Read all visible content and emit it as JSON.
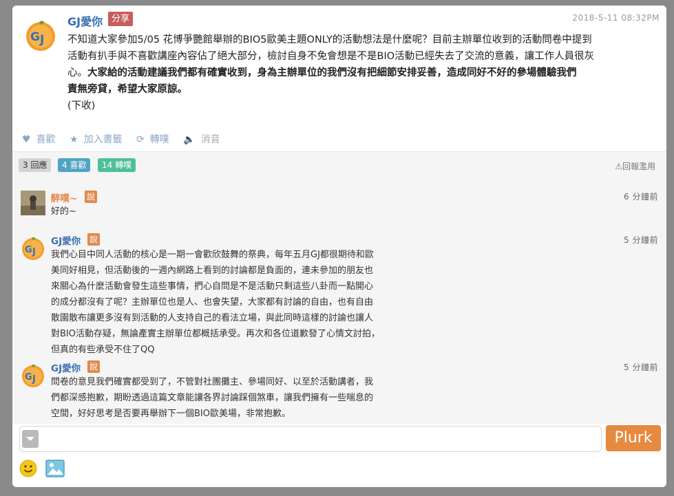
{
  "post": {
    "author": "GJ愛你",
    "qualifier": "分享",
    "timestamp": "2018-5-11 08:32PM",
    "line1": "不知道大家參加5/05 花博爭艷館舉辦的BIO5歐美主題ONLY的活動想法是什麼呢？目前主辦單位收到的活動問卷中提到",
    "line2": "活動有扒手與不喜歡講座內容佔了絕大部分，檢討自身不免會想是不是BIO活動已經失去了交流的意義，讓工作人員很灰",
    "line3a": "心。",
    "line3b": "大家給的活動建議我們都有確實收到，身為主辦單位的我們沒有把細節安排妥善，造成同好不好的參場體驗我們",
    "line4": "責無旁貸，希望大家原諒。",
    "line5": "(下收)"
  },
  "actions": {
    "like": "喜歡",
    "bookmark": "加入書籤",
    "replurk": "轉噗",
    "mute": "消音"
  },
  "stats": {
    "responses": "3 回應",
    "likes": "4 喜歡",
    "replurks": "14 轉噗",
    "report": "回報濫用"
  },
  "responses": [
    {
      "name": "醉噗~",
      "qualifier": "說",
      "time": "6 分鐘前",
      "lines": [
        "好的~"
      ],
      "name_color": "#e8834a"
    },
    {
      "name": "GJ愛你",
      "qualifier": "說",
      "time": "5 分鐘前",
      "lines": [
        "我們心目中同人活動的核心是一期一會歡欣鼓舞的祭典，每年五月GJ都很期待和歐",
        "美同好相見，但活動後的一週內網路上看到的討論都是負面的，連未參加的朋友也",
        "來關心為什麼活動會發生這些事情，捫心自問是不是活動只剩這些八卦而一點開心",
        "的成分都沒有了呢？主辦單位也是人、也會失望，大家都有討論的自由，也有自由",
        "散園散布讓更多沒有到活動的人支持自己的看法立場，與此同時這樣的討論也讓人",
        "對BIO活動存疑，無論產實主辦單位都概括承受。再次和各位道歉發了心情文討拍，",
        "但真的有些承受不住了QQ"
      ],
      "name_color": "#3a6fb0"
    },
    {
      "name": "GJ愛你",
      "qualifier": "說",
      "time": "5 分鐘前",
      "lines": [
        "問卷的意見我們確實都受到了，不管對社團攤主、參場同好、以至於活動講者，我",
        "們都深感抱歉，期盼透過這篇文章能讓各界討論踩個煞車，讓我們擁有一些喘息的",
        "空間，好好思考是否要再舉辦下一個BIO歐美場，非常抱歉。"
      ],
      "name_color": "#3a6fb0"
    }
  ],
  "composer": {
    "placeholder": "",
    "submit": "Plurk"
  }
}
